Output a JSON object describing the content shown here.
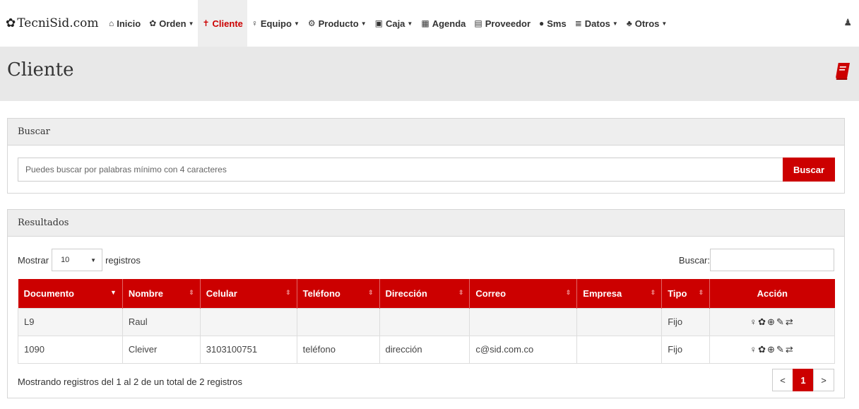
{
  "brand": {
    "logo_icon": "gears-icon",
    "name": "TecniSid.com"
  },
  "nav": [
    {
      "icon": "⌂",
      "label": "Inicio",
      "caret": false,
      "active": false
    },
    {
      "icon": "✿",
      "label": "Orden",
      "caret": true,
      "active": false
    },
    {
      "icon": "✝",
      "label": "Cliente",
      "caret": false,
      "active": true
    },
    {
      "icon": "♀",
      "label": "Equipo",
      "caret": true,
      "active": false
    },
    {
      "icon": "⚙",
      "label": "Producto",
      "caret": true,
      "active": false
    },
    {
      "icon": "▣",
      "label": "Caja",
      "caret": true,
      "active": false
    },
    {
      "icon": "▦",
      "label": "Agenda",
      "caret": false,
      "active": false
    },
    {
      "icon": "▤",
      "label": "Proveedor",
      "caret": false,
      "active": false
    },
    {
      "icon": "●",
      "label": "Sms",
      "caret": false,
      "active": false
    },
    {
      "icon": "≣",
      "label": "Datos",
      "caret": true,
      "active": false
    },
    {
      "icon": "♣",
      "label": "Otros",
      "caret": true,
      "active": false
    }
  ],
  "page": {
    "title": "Cliente"
  },
  "search_panel": {
    "title": "Buscar",
    "placeholder": "Puedes buscar por palabras mínimo con 4 caracteres",
    "button": "Buscar"
  },
  "results_panel": {
    "title": "Resultados",
    "show_label": "Mostrar",
    "page_length": "10",
    "records_label": "registros",
    "filter_label": "Buscar:",
    "columns": [
      "Documento",
      "Nombre",
      "Celular",
      "Teléfono",
      "Dirección",
      "Correo",
      "Empresa",
      "Tipo",
      "Acción"
    ],
    "rows": [
      [
        "L9",
        "Raul",
        "",
        "",
        "",
        "",
        "",
        "Fijo"
      ],
      [
        "1090",
        "Cleiver",
        "3103100751",
        "teléfono",
        "dirección",
        "c@sid.com.co",
        "",
        "Fijo"
      ]
    ],
    "row_actions": [
      "equipo-icon",
      "orden-gear-icon",
      "view-icon",
      "edit-icon",
      "transfer-icon"
    ],
    "info": "Mostrando registros del 1 al 2 de un total de 2 registros",
    "pager": {
      "prev": "<",
      "current": "1",
      "next": ">"
    }
  },
  "colors": {
    "accent": "#cc0000",
    "header_bg": "#e8e8e8"
  }
}
